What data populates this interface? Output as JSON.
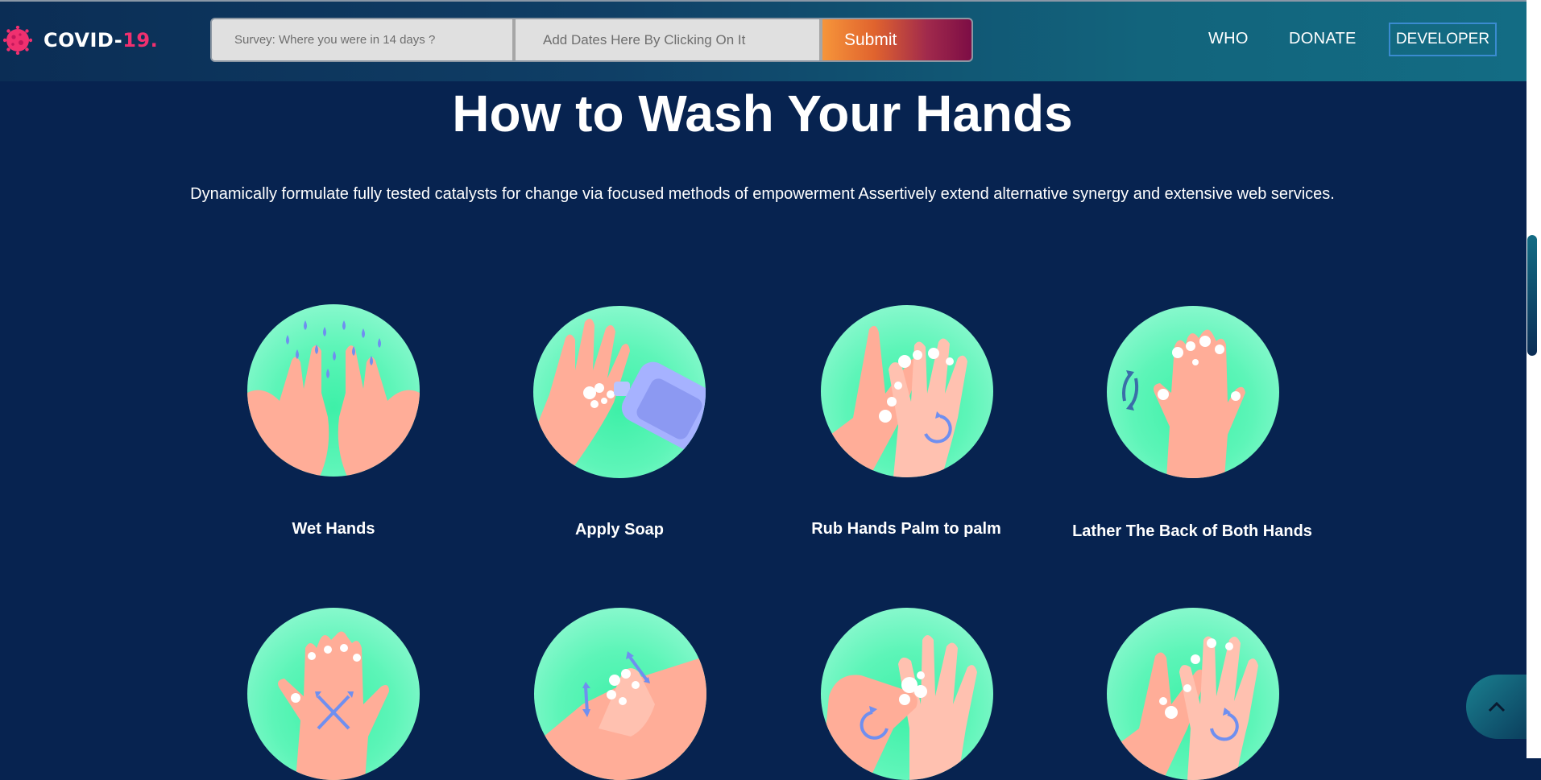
{
  "brand": {
    "name": "COVID-",
    "accent": "19."
  },
  "survey": {
    "placeholder": "Survey:  Where you were in 14 days ?",
    "dates_placeholder": "Add Dates Here By Clicking On It",
    "submit_label": "Submit"
  },
  "nav": {
    "who": "WHO",
    "donate": "DONATE",
    "developer": "DEVELOPER"
  },
  "main": {
    "title": "How to Wash Your Hands",
    "intro": "Dynamically formulate fully tested catalysts for change via focused methods of empowerment Assertively extend alternative synergy and extensive web services.",
    "steps": [
      {
        "label": "Wet Hands",
        "icon": "wet-hands-icon"
      },
      {
        "label": "Apply Soap",
        "icon": "apply-soap-icon"
      },
      {
        "label": "Rub Hands Palm to palm",
        "icon": "rub-palms-icon"
      },
      {
        "label": "Lather The Back of Both Hands",
        "icon": "lather-back-icon"
      },
      {
        "label": "",
        "icon": "interlace-fingers-icon"
      },
      {
        "label": "",
        "icon": "scrub-thumbs-icon"
      },
      {
        "label": "",
        "icon": "scrub-fingertips-icon"
      },
      {
        "label": "",
        "icon": "rinse-hands-icon"
      }
    ]
  },
  "colors": {
    "background": "#072350",
    "brand_accent": "#f0306f",
    "circle": "#5df5b8",
    "skin": "#ffad98",
    "water": "#6f8ff0",
    "developer_border": "#3a8bd0"
  }
}
